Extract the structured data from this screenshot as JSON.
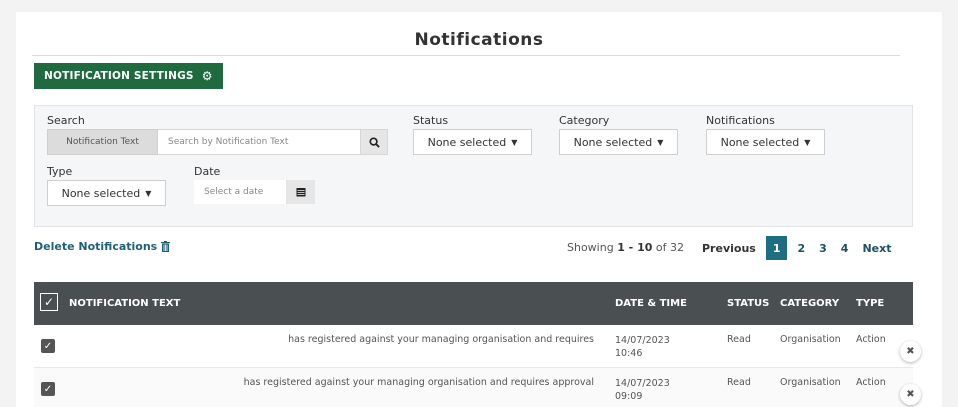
{
  "page": {
    "title": "Notifications"
  },
  "toolbar": {
    "settings_label": "NOTIFICATION SETTINGS"
  },
  "filters": {
    "search_label": "Search",
    "search_addon": "Notification Text",
    "search_placeholder": "Search by Notification Text",
    "status_label": "Status",
    "status_value": "None selected",
    "category_label": "Category",
    "category_value": "None selected",
    "notifications_label": "Notifications",
    "notifications_value": "None selected",
    "type_label": "Type",
    "type_value": "None selected",
    "date_label": "Date",
    "date_placeholder": "Select a date"
  },
  "actions": {
    "delete_label": "Delete Notifications"
  },
  "pagination": {
    "showing_prefix": "Showing",
    "range": "1 - 10",
    "of_word": "of",
    "total": "32",
    "previous": "Previous",
    "pages": [
      "1",
      "2",
      "3",
      "4"
    ],
    "active_page": "1",
    "next": "Next"
  },
  "table": {
    "headers": [
      "NOTIFICATION TEXT",
      "DATE & TIME",
      "STATUS",
      "CATEGORY",
      "TYPE"
    ],
    "rows": [
      {
        "text": "has registered against your managing organisation and requires",
        "date": "14/07/2023",
        "time": "10:46",
        "status": "Read",
        "category": "Organisation",
        "type": "Action"
      },
      {
        "text": "has registered against your managing organisation and requires approval",
        "date": "14/07/2023",
        "time": "09:09",
        "status": "Read",
        "category": "Organisation",
        "type": "Action"
      }
    ]
  },
  "colors": {
    "primary_green": "#1f6b3f",
    "header_dark": "#4a4f52",
    "link_blue": "#1f5f78",
    "active_page": "#1e6d82"
  }
}
